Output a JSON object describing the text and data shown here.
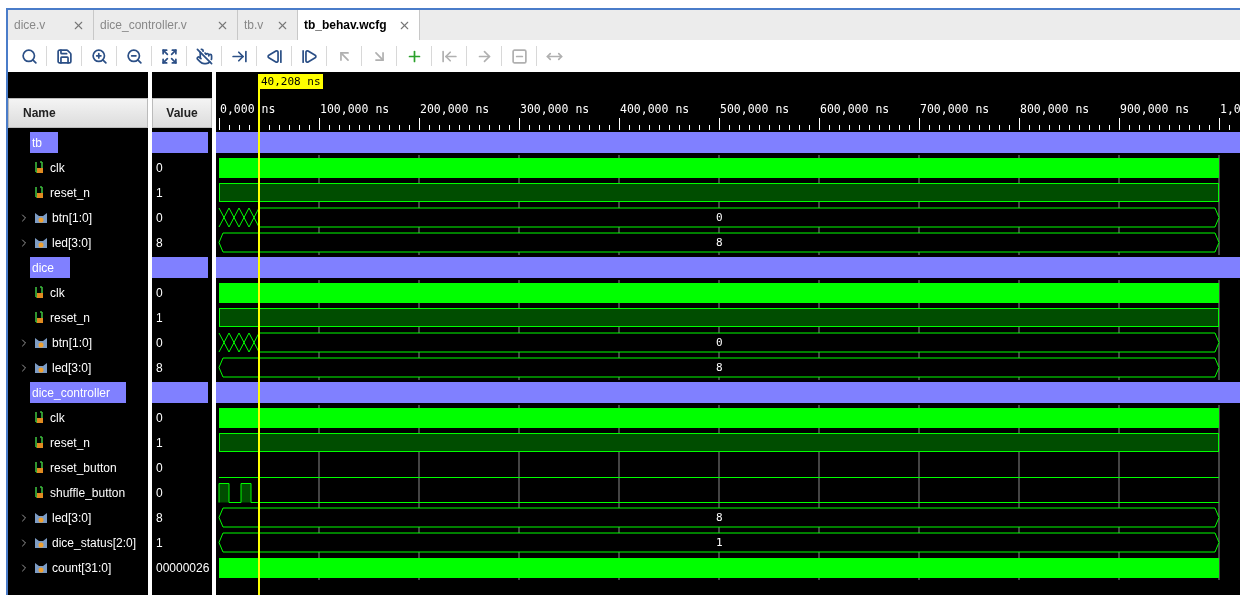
{
  "tabs": [
    {
      "label": "dice.v",
      "selected": false
    },
    {
      "label": "dice_controller.v",
      "selected": false
    },
    {
      "label": "tb.v",
      "selected": false
    },
    {
      "label": "tb_behav.wcfg",
      "selected": true
    }
  ],
  "toolbar": [
    {
      "disabled": false
    },
    {
      "disabled": false
    },
    {
      "disabled": false
    },
    {
      "disabled": false
    },
    {
      "disabled": false
    },
    {
      "disabled": false
    },
    {
      "disabled": false
    },
    {
      "disabled": false
    },
    {
      "disabled": false
    },
    {
      "disabled": true
    },
    {
      "disabled": true
    },
    {
      "disabled": false
    },
    {
      "disabled": true
    },
    {
      "disabled": true
    },
    {
      "disabled": true
    },
    {
      "disabled": true
    }
  ],
  "cursor": {
    "label": "40,208 ns"
  },
  "columns": {
    "name": "Name",
    "value": "Value"
  },
  "ruler": [
    "0,000 ns",
    "100,000 ns",
    "200,000 ns",
    "300,000 ns",
    "400,000 ns",
    "500,000 ns",
    "600,000 ns",
    "700,000 ns",
    "800,000 ns",
    "900,000 ns",
    "1,0"
  ],
  "signals": [
    {
      "kind": "group",
      "name": "tb"
    },
    {
      "kind": "clock",
      "name": "clk",
      "value": "0"
    },
    {
      "kind": "high",
      "name": "reset_n",
      "value": "1"
    },
    {
      "kind": "bus_toggle",
      "name": "btn[1:0]",
      "value": "0",
      "wave_label": "0",
      "expanded": false
    },
    {
      "kind": "bus",
      "name": "led[3:0]",
      "value": "8",
      "wave_label": "8",
      "expanded": false
    },
    {
      "kind": "group",
      "name": "dice"
    },
    {
      "kind": "clock",
      "name": "clk",
      "value": "0"
    },
    {
      "kind": "high",
      "name": "reset_n",
      "value": "1"
    },
    {
      "kind": "bus_toggle",
      "name": "btn[1:0]",
      "value": "0",
      "wave_label": "0",
      "expanded": false
    },
    {
      "kind": "bus",
      "name": "led[3:0]",
      "value": "8",
      "wave_label": "8",
      "expanded": false
    },
    {
      "kind": "group",
      "name": "dice_controller"
    },
    {
      "kind": "clock",
      "name": "clk",
      "value": "0"
    },
    {
      "kind": "high",
      "name": "reset_n",
      "value": "1"
    },
    {
      "kind": "low",
      "name": "reset_button",
      "value": "0"
    },
    {
      "kind": "pulses",
      "name": "shuffle_button",
      "value": "0"
    },
    {
      "kind": "bus",
      "name": "led[3:0]",
      "value": "8",
      "wave_label": "8",
      "expanded": false
    },
    {
      "kind": "bus",
      "name": "dice_status[2:0]",
      "value": "1",
      "wave_label": "1",
      "expanded": false
    },
    {
      "kind": "bus_dense",
      "name": "count[31:0]",
      "value": "00000026",
      "expanded": false
    }
  ]
}
